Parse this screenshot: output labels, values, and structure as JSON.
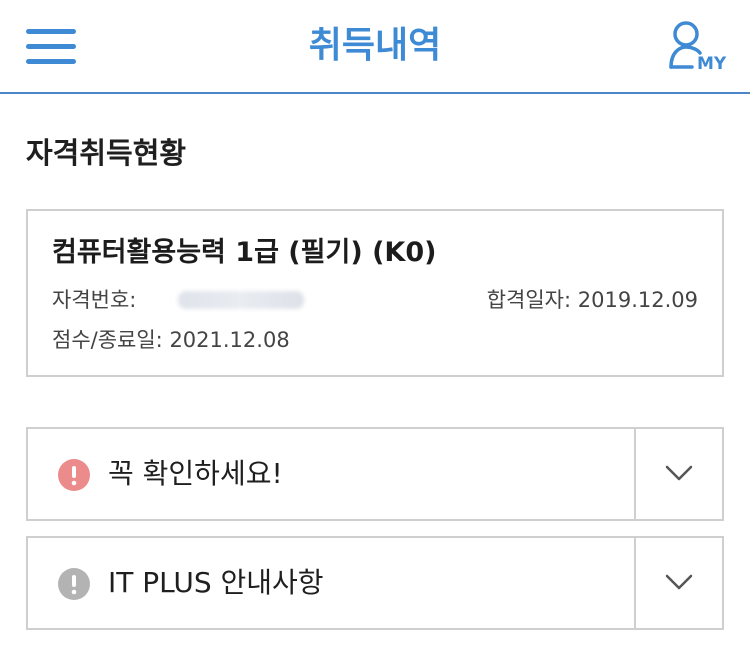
{
  "header": {
    "title": "취득내역",
    "my_label": "MY"
  },
  "section": {
    "title": "자격취득현황"
  },
  "certificate": {
    "name": "컴퓨터활용능력 1급 (필기) (K0)",
    "number_label": "자격번호:",
    "pass_date_label": "합격일자:",
    "pass_date": "2019.12.09",
    "score_date_label": "점수/종료일:",
    "score_date": "2021.12.08"
  },
  "accordions": [
    {
      "label": "꼭 확인하세요!",
      "icon": "alert-icon",
      "icon_color": "#ec8b8b"
    },
    {
      "label": "IT PLUS 안내사항",
      "icon": "info-icon",
      "icon_color": "#b3b3b3"
    }
  ],
  "colors": {
    "accent": "#3f8ad4",
    "border": "#cfcfcf"
  }
}
